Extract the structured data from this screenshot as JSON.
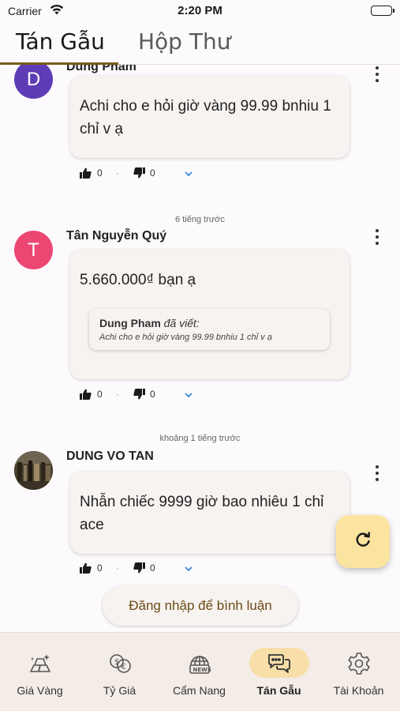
{
  "status_bar": {
    "carrier": "Carrier",
    "time": "2:20 PM"
  },
  "top_tabs": {
    "active": "Tán Gẫu",
    "inactive": "Hộp Thư"
  },
  "posts": [
    {
      "author": "Dung Pham",
      "avatar_letter": "D",
      "avatar_color": "#5e3cb5",
      "message": "Achi cho e hỏi giờ vàng 99.99 bnhiu 1 chỉ v ạ",
      "likes": "0",
      "dislikes": "0"
    },
    {
      "timestamp": "6 tiếng trước",
      "author": "Tân Nguyễn Quý",
      "avatar_letter": "T",
      "avatar_color": "#ec4673",
      "message": "5.660.000₫ bạn ạ",
      "quote": {
        "name": "Dung Pham",
        "verb": "đã viết:",
        "text": "Achi cho e hỏi giờ vàng 99.99 bnhiu 1 chỉ v ạ"
      },
      "likes": "0",
      "dislikes": "0"
    },
    {
      "timestamp": "khoảng 1 tiếng trước",
      "author": "DUNG VO TAN",
      "avatar_icon": "photo-avatar",
      "message": "Nhẫn chiếc 9999 giờ bao nhiêu 1 chỉ ace",
      "likes": "0",
      "dislikes": "0"
    }
  ],
  "login_button": "Đăng nhập để bình luận",
  "refresh_icon": "refresh-icon",
  "bottom_nav": [
    {
      "label": "Giá Vàng",
      "icon": "gold-bars-icon"
    },
    {
      "label": "Tỷ Giá",
      "icon": "currency-exchange-icon"
    },
    {
      "label": "Cẩm Nang",
      "icon": "news-globe-icon"
    },
    {
      "label": "Tán Gẫu",
      "icon": "chat-bubbles-icon",
      "active": true
    },
    {
      "label": "Tài Khoản",
      "icon": "gear-icon"
    }
  ],
  "colors": {
    "accent": "#f8dfa9",
    "underline": "#7a5a1a",
    "background": "#fcfafc"
  }
}
